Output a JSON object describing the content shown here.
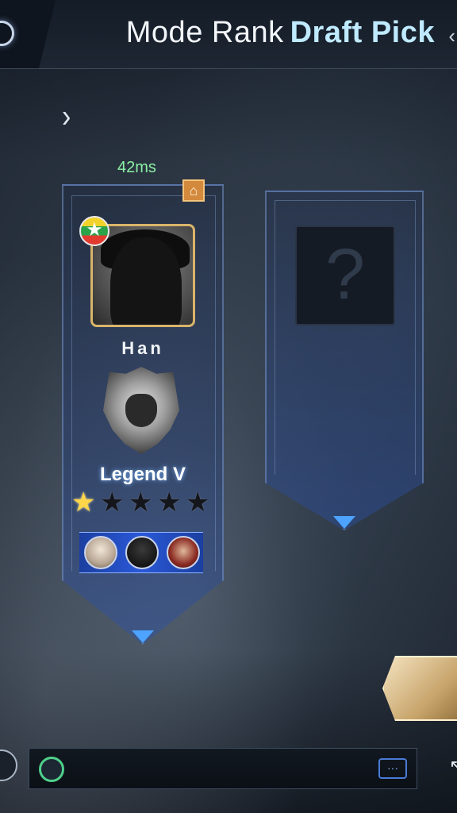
{
  "header": {
    "mode_text": "Mode Rank",
    "draft_text": "Draft Pick"
  },
  "lobby": {
    "ping": "42ms",
    "player": {
      "name": "Han",
      "rank": "Legend V",
      "stars_filled": 1,
      "stars_total": 5,
      "recent_heroes": [
        "hero-portrait-1",
        "hero-portrait-2",
        "hero-portrait-3"
      ]
    },
    "empty_slot_symbol": "?"
  },
  "chat": {
    "placeholder": "",
    "send_symbol": "···"
  },
  "colors": {
    "accent_blue": "#4da3ff",
    "ping_green": "#8bf0a4",
    "gold": "#d9b46a",
    "title_highlight": "#bfeaff"
  },
  "icons": {
    "back": "back-circle-icon",
    "expand": "chevron-right-icon",
    "home": "home-icon",
    "flag": "star-flag-icon",
    "rank": "rank-emblem-icon",
    "star": "star-icon",
    "chat_emoji": "emoji-icon",
    "chat_send": "chat-bubble-icon",
    "mic": "mic-icon"
  }
}
